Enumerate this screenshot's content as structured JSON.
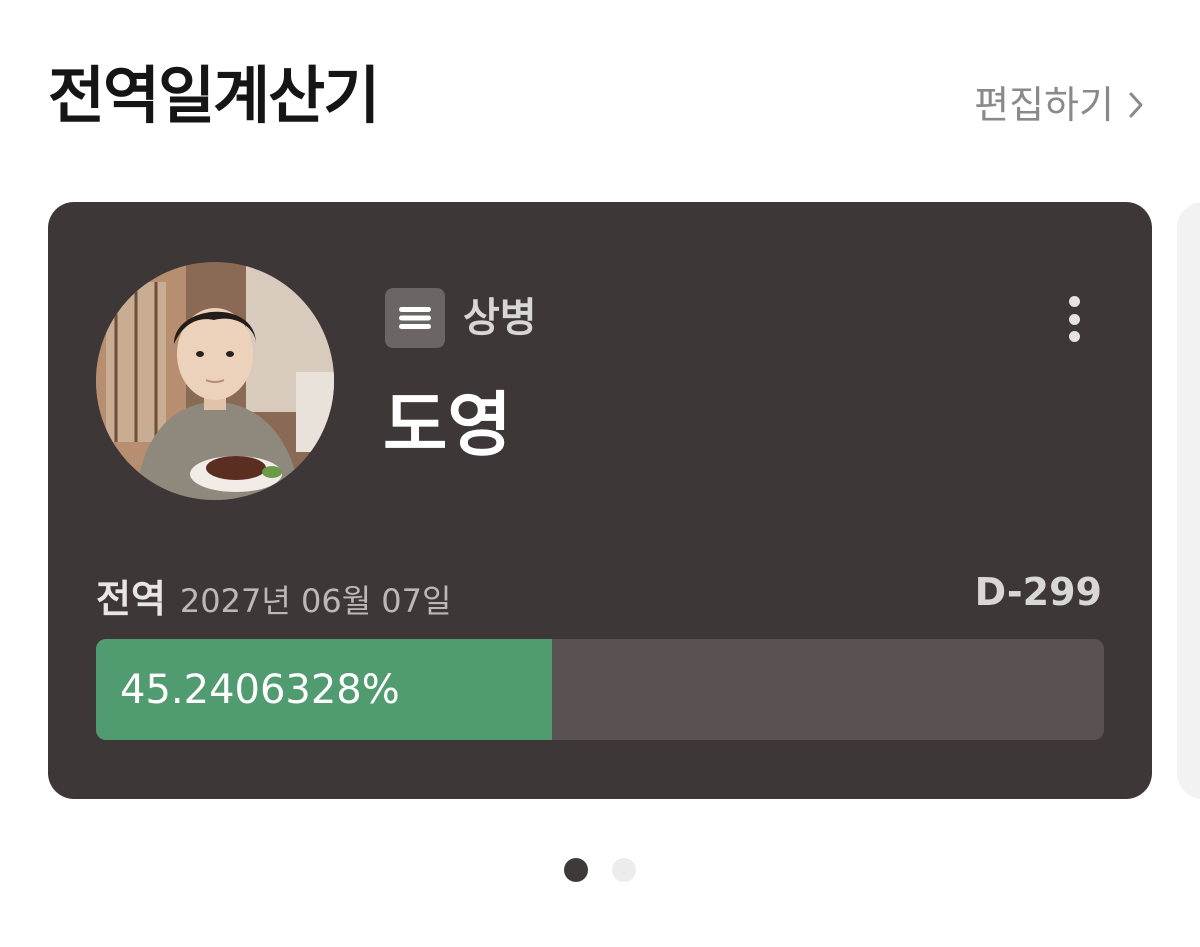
{
  "header": {
    "title": "전역일계산기",
    "edit_label": "편집하기"
  },
  "card": {
    "rank": "상병",
    "name": "도영",
    "discharge_label": "전역",
    "discharge_date": "2027년 06월 07일",
    "dday": "D-299",
    "progress_text": "45.2406328%",
    "progress_fraction": 0.452406328,
    "colors": {
      "card_bg": "#3e3738",
      "progress_fill": "#519b71",
      "progress_track": "#5a5152"
    },
    "icons": {
      "rank": "menu-icon",
      "more": "more-vertical-icon",
      "edit": "chevron-right-icon"
    }
  },
  "pager": {
    "count": 2,
    "active_index": 0
  }
}
